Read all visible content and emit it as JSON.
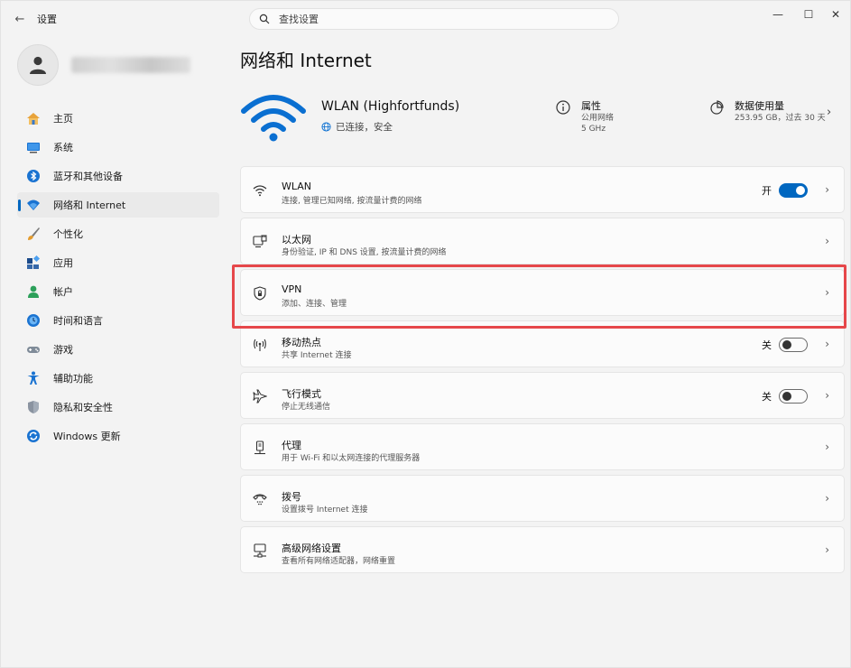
{
  "titlebar": {
    "back_glyph": "←",
    "app_title": "设置",
    "search_placeholder": "查找设置",
    "minimize_glyph": "—",
    "maximize_glyph": "☐",
    "close_glyph": "✕"
  },
  "sidebar": {
    "items": [
      {
        "label": "主页",
        "icon": "home-icon"
      },
      {
        "label": "系统",
        "icon": "system-icon"
      },
      {
        "label": "蓝牙和其他设备",
        "icon": "bluetooth-icon"
      },
      {
        "label": "网络和 Internet",
        "icon": "network-icon",
        "active": true
      },
      {
        "label": "个性化",
        "icon": "brush-icon"
      },
      {
        "label": "应用",
        "icon": "apps-icon"
      },
      {
        "label": "帐户",
        "icon": "account-icon"
      },
      {
        "label": "时间和语言",
        "icon": "time-language-icon"
      },
      {
        "label": "游戏",
        "icon": "gaming-icon"
      },
      {
        "label": "辅助功能",
        "icon": "accessibility-icon"
      },
      {
        "label": "隐私和安全性",
        "icon": "shield-icon"
      },
      {
        "label": "Windows 更新",
        "icon": "windows-update-icon"
      }
    ]
  },
  "main": {
    "title": "网络和 Internet",
    "connection": {
      "name": "WLAN (Highfortfunds)",
      "status": "已连接，安全"
    },
    "properties": {
      "title": "属性",
      "network_type": "公用网络",
      "band": "5 GHz"
    },
    "data_usage": {
      "title": "数据使用量",
      "detail": "253.95 GB，过去 30 天"
    },
    "chevron": "›",
    "items": [
      {
        "title": "WLAN",
        "subtitle": "连接, 管理已知网络, 按流量计费的网络",
        "icon": "wifi-icon",
        "toggle_label": "开"
      },
      {
        "title": "以太网",
        "subtitle": "身份验证, IP 和 DNS 设置, 按流量计费的网络",
        "icon": "ethernet-icon"
      },
      {
        "title": "VPN",
        "subtitle": "添加、连接、管理",
        "icon": "vpn-shield-icon"
      },
      {
        "title": "移动热点",
        "subtitle": "共享 Internet 连接",
        "icon": "hotspot-icon",
        "toggle_label": "关"
      },
      {
        "title": "飞行模式",
        "subtitle": "停止无线通信",
        "icon": "airplane-icon",
        "toggle_label": "关"
      },
      {
        "title": "代理",
        "subtitle": "用于 Wi-Fi 和以太网连接的代理服务器",
        "icon": "proxy-icon"
      },
      {
        "title": "拨号",
        "subtitle": "设置拨号 Internet 连接",
        "icon": "dialup-icon"
      },
      {
        "title": "高级网络设置",
        "subtitle": "查看所有网络适配器，网络重置",
        "icon": "advanced-network-icon"
      }
    ]
  },
  "colors": {
    "accent": "#0067c0",
    "highlight": "#e6474a"
  }
}
